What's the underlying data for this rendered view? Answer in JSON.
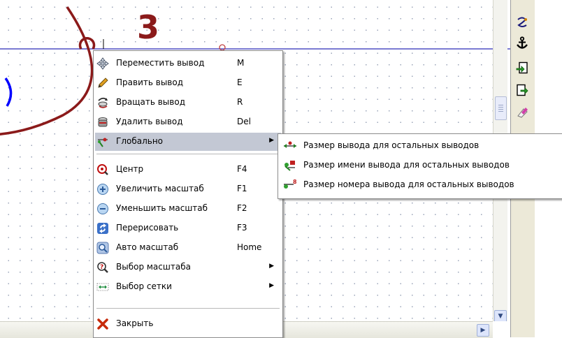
{
  "canvas": {
    "reference_number": "3",
    "colors": {
      "pin": "#8b1a1a",
      "wire": "#2a2ab8",
      "selection": "#0000ff",
      "grid_dot": "#9aa3b8"
    }
  },
  "context_menu": {
    "items": [
      {
        "label": "Переместить вывод",
        "shortcut": "M",
        "icon": "move-icon"
      },
      {
        "label": "Править вывод",
        "shortcut": "E",
        "icon": "pencil-icon"
      },
      {
        "label": "Вращать вывод",
        "shortcut": "R",
        "icon": "rotate-icon"
      },
      {
        "label": "Удалить вывод",
        "shortcut": "Del",
        "icon": "delete-icon"
      },
      {
        "label": "Глобально",
        "shortcut": "",
        "icon": "global-pin-icon",
        "submenu": true,
        "highlighted": true
      },
      {
        "label": "Центр",
        "shortcut": "F4",
        "icon": "center-icon"
      },
      {
        "label": "Увеличить масштаб",
        "shortcut": "F1",
        "icon": "zoom-in-icon"
      },
      {
        "label": "Уменьшить масштаб",
        "shortcut": "F2",
        "icon": "zoom-out-icon"
      },
      {
        "label": "Перерисовать",
        "shortcut": "F3",
        "icon": "redraw-icon"
      },
      {
        "label": "Авто масштаб",
        "shortcut": "Home",
        "icon": "auto-zoom-icon"
      },
      {
        "label": "Выбор масштаба",
        "shortcut": "",
        "icon": "zoom-select-icon",
        "submenu": true
      },
      {
        "label": "Выбор сетки",
        "shortcut": "",
        "icon": "grid-select-icon",
        "submenu": true
      },
      {
        "label": "Закрыть",
        "shortcut": "",
        "icon": "close-icon"
      }
    ]
  },
  "submenu": {
    "items": [
      {
        "label": "Размер вывода для остальных выводов",
        "icon": "pin-size-icon"
      },
      {
        "label": "Размер имени вывода для остальных выводов",
        "icon": "pin-name-size-icon"
      },
      {
        "label": "Размер номера вывода для остальных выводов",
        "icon": "pin-number-size-icon"
      }
    ]
  },
  "toolbar": {
    "buttons": [
      {
        "icon": "wire-icon"
      },
      {
        "icon": "anchor-icon"
      },
      {
        "icon": "import-icon"
      },
      {
        "icon": "export-icon"
      },
      {
        "icon": "eraser-icon"
      }
    ]
  },
  "scrollbars": {
    "down_arrow": "▼",
    "right_arrow": "▶"
  }
}
